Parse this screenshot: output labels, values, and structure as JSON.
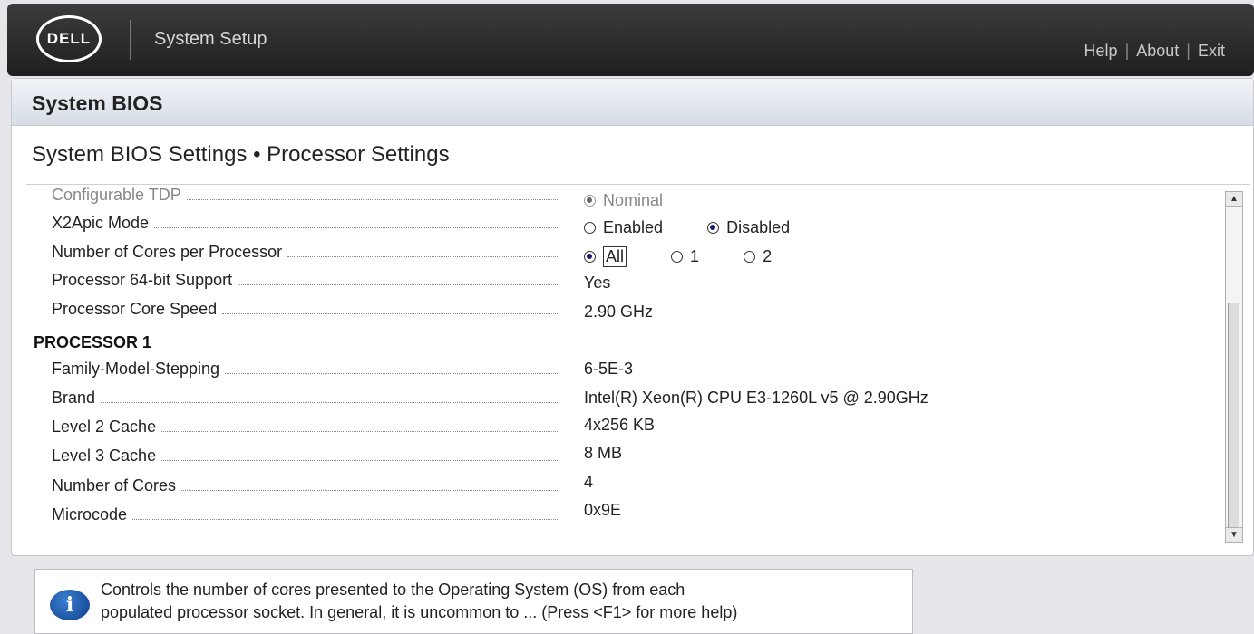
{
  "header": {
    "logo_text": "DELL",
    "app_title": "System Setup",
    "links": [
      "Help",
      "About",
      "Exit"
    ],
    "separator": "|"
  },
  "panel": {
    "title": "System BIOS",
    "section_title": "System BIOS Settings • Processor Settings"
  },
  "settings": [
    {
      "label": "Configurable TDP",
      "type": "radio",
      "dim": true,
      "options": [
        {
          "label": "Nominal",
          "selected": true
        }
      ]
    },
    {
      "label": "X2Apic Mode",
      "type": "radio",
      "options": [
        {
          "label": "Enabled",
          "selected": false
        },
        {
          "label": "Disabled",
          "selected": true
        }
      ]
    },
    {
      "label": "Number of Cores per Processor",
      "type": "radio",
      "options": [
        {
          "label": "All",
          "selected": true,
          "focused": true
        },
        {
          "label": "1",
          "selected": false
        },
        {
          "label": "2",
          "selected": false
        }
      ]
    },
    {
      "label": "Processor 64-bit Support",
      "type": "text",
      "value": "Yes"
    },
    {
      "label": "Processor Core Speed",
      "type": "text",
      "value": "2.90 GHz"
    }
  ],
  "processor_group": {
    "heading": "PROCESSOR 1",
    "items": [
      {
        "label": "Family-Model-Stepping",
        "value": "6-5E-3"
      },
      {
        "label": "Brand",
        "value": "Intel(R) Xeon(R) CPU E3-1260L v5 @ 2.90GHz"
      },
      {
        "label": "Level 2 Cache",
        "value": "4x256 KB"
      },
      {
        "label": "Level 3 Cache",
        "value": "8 MB"
      },
      {
        "label": "Number of Cores",
        "value": "4"
      },
      {
        "label": "Microcode",
        "value": "0x9E"
      }
    ]
  },
  "help": {
    "icon": "info-icon",
    "icon_glyph": "i",
    "line1": "Controls the number of cores presented to the Operating System (OS) from each",
    "line2": "populated processor socket. In general, it is uncommon to ... (Press <F1> for more help)"
  },
  "scrollbar": {
    "up_glyph": "▲",
    "down_glyph": "▼"
  }
}
